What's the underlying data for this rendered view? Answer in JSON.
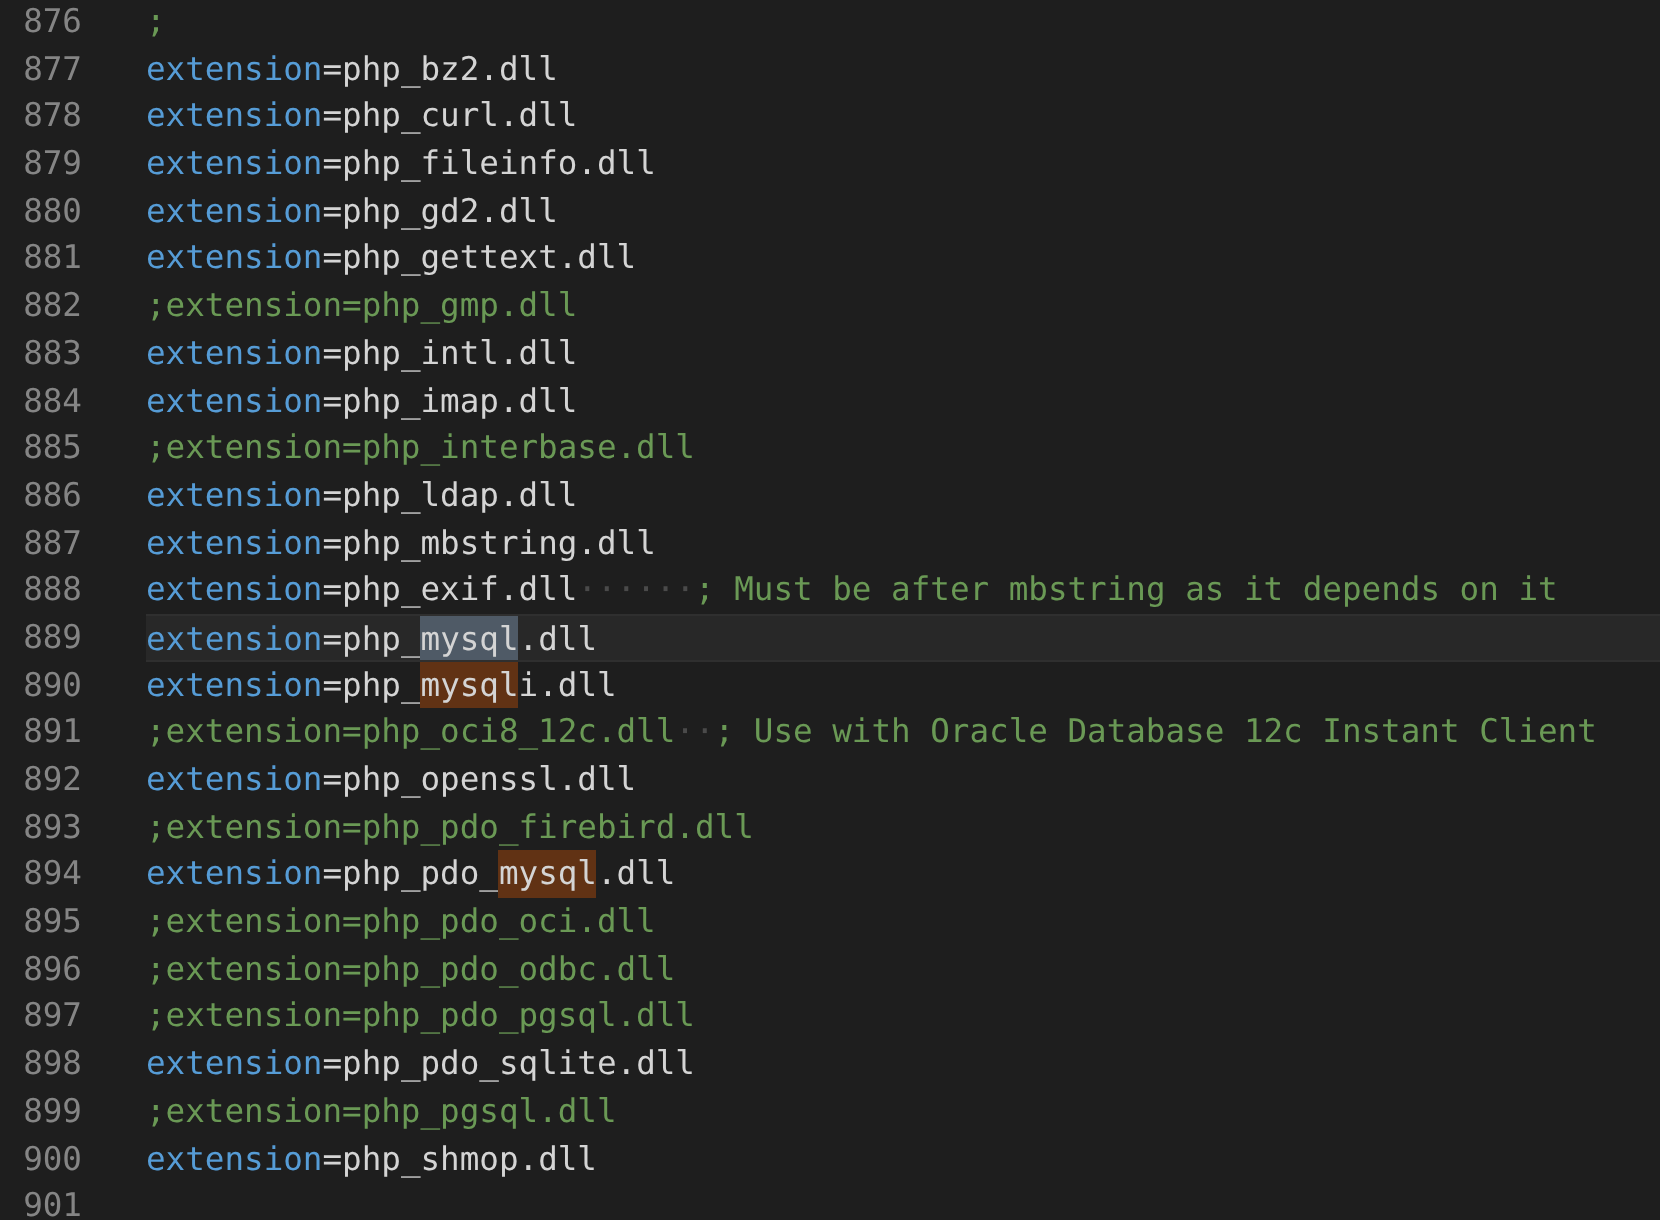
{
  "editor": {
    "lines": [
      {
        "number": "876",
        "current": false,
        "tokens": [
          {
            "kind": "comment",
            "text": ";"
          }
        ]
      },
      {
        "number": "877",
        "current": false,
        "tokens": [
          {
            "kind": "key",
            "text": "extension"
          },
          {
            "kind": "operator",
            "text": "="
          },
          {
            "kind": "value",
            "text": "php_bz2.dll"
          }
        ]
      },
      {
        "number": "878",
        "current": false,
        "tokens": [
          {
            "kind": "key",
            "text": "extension"
          },
          {
            "kind": "operator",
            "text": "="
          },
          {
            "kind": "value",
            "text": "php_curl.dll"
          }
        ]
      },
      {
        "number": "879",
        "current": false,
        "tokens": [
          {
            "kind": "key",
            "text": "extension"
          },
          {
            "kind": "operator",
            "text": "="
          },
          {
            "kind": "value",
            "text": "php_fileinfo.dll"
          }
        ]
      },
      {
        "number": "880",
        "current": false,
        "tokens": [
          {
            "kind": "key",
            "text": "extension"
          },
          {
            "kind": "operator",
            "text": "="
          },
          {
            "kind": "value",
            "text": "php_gd2.dll"
          }
        ]
      },
      {
        "number": "881",
        "current": false,
        "tokens": [
          {
            "kind": "key",
            "text": "extension"
          },
          {
            "kind": "operator",
            "text": "="
          },
          {
            "kind": "value",
            "text": "php_gettext.dll"
          }
        ]
      },
      {
        "number": "882",
        "current": false,
        "tokens": [
          {
            "kind": "comment",
            "text": ";extension=php_gmp.dll"
          }
        ]
      },
      {
        "number": "883",
        "current": false,
        "tokens": [
          {
            "kind": "key",
            "text": "extension"
          },
          {
            "kind": "operator",
            "text": "="
          },
          {
            "kind": "value",
            "text": "php_intl.dll"
          }
        ]
      },
      {
        "number": "884",
        "current": false,
        "tokens": [
          {
            "kind": "key",
            "text": "extension"
          },
          {
            "kind": "operator",
            "text": "="
          },
          {
            "kind": "value",
            "text": "php_imap.dll"
          }
        ]
      },
      {
        "number": "885",
        "current": false,
        "tokens": [
          {
            "kind": "comment",
            "text": ";extension=php_interbase.dll"
          }
        ]
      },
      {
        "number": "886",
        "current": false,
        "tokens": [
          {
            "kind": "key",
            "text": "extension"
          },
          {
            "kind": "operator",
            "text": "="
          },
          {
            "kind": "value",
            "text": "php_ldap.dll"
          }
        ]
      },
      {
        "number": "887",
        "current": false,
        "tokens": [
          {
            "kind": "key",
            "text": "extension"
          },
          {
            "kind": "operator",
            "text": "="
          },
          {
            "kind": "value",
            "text": "php_mbstring.dll"
          }
        ]
      },
      {
        "number": "888",
        "current": false,
        "tokens": [
          {
            "kind": "key",
            "text": "extension"
          },
          {
            "kind": "operator",
            "text": "="
          },
          {
            "kind": "value",
            "text": "php_exif.dll"
          },
          {
            "kind": "whitespace",
            "text": "······"
          },
          {
            "kind": "comment",
            "text": "; Must be after mbstring as it depends on it"
          }
        ]
      },
      {
        "number": "889",
        "current": true,
        "tokens": [
          {
            "kind": "key",
            "text": "extension"
          },
          {
            "kind": "operator",
            "text": "="
          },
          {
            "kind": "value",
            "text": "php_"
          },
          {
            "kind": "selection",
            "text": "mysql"
          },
          {
            "kind": "value",
            "text": ".dll"
          }
        ]
      },
      {
        "number": "890",
        "current": false,
        "tokens": [
          {
            "kind": "key",
            "text": "extension"
          },
          {
            "kind": "operator",
            "text": "="
          },
          {
            "kind": "value",
            "text": "php_"
          },
          {
            "kind": "match",
            "text": "mysql"
          },
          {
            "kind": "value",
            "text": "i.dll"
          }
        ]
      },
      {
        "number": "891",
        "current": false,
        "tokens": [
          {
            "kind": "comment",
            "text": ";extension=php_oci8_12c.dll"
          },
          {
            "kind": "whitespace",
            "text": "··"
          },
          {
            "kind": "comment",
            "text": "; Use with Oracle Database 12c Instant Client"
          }
        ]
      },
      {
        "number": "892",
        "current": false,
        "tokens": [
          {
            "kind": "key",
            "text": "extension"
          },
          {
            "kind": "operator",
            "text": "="
          },
          {
            "kind": "value",
            "text": "php_openssl.dll"
          }
        ]
      },
      {
        "number": "893",
        "current": false,
        "tokens": [
          {
            "kind": "comment",
            "text": ";extension=php_pdo_firebird.dll"
          }
        ]
      },
      {
        "number": "894",
        "current": false,
        "tokens": [
          {
            "kind": "key",
            "text": "extension"
          },
          {
            "kind": "operator",
            "text": "="
          },
          {
            "kind": "value",
            "text": "php_pdo_"
          },
          {
            "kind": "match",
            "text": "mysql"
          },
          {
            "kind": "value",
            "text": ".dll"
          }
        ]
      },
      {
        "number": "895",
        "current": false,
        "tokens": [
          {
            "kind": "comment",
            "text": ";extension=php_pdo_oci.dll"
          }
        ]
      },
      {
        "number": "896",
        "current": false,
        "tokens": [
          {
            "kind": "comment",
            "text": ";extension=php_pdo_odbc.dll"
          }
        ]
      },
      {
        "number": "897",
        "current": false,
        "tokens": [
          {
            "kind": "comment",
            "text": ";extension=php_pdo_pgsql.dll"
          }
        ]
      },
      {
        "number": "898",
        "current": false,
        "tokens": [
          {
            "kind": "key",
            "text": "extension"
          },
          {
            "kind": "operator",
            "text": "="
          },
          {
            "kind": "value",
            "text": "php_pdo_sqlite.dll"
          }
        ]
      },
      {
        "number": "899",
        "current": false,
        "tokens": [
          {
            "kind": "comment",
            "text": ";extension=php_pgsql.dll"
          }
        ]
      },
      {
        "number": "900",
        "current": false,
        "tokens": [
          {
            "kind": "key",
            "text": "extension"
          },
          {
            "kind": "operator",
            "text": "="
          },
          {
            "kind": "value",
            "text": "php_shmop.dll"
          }
        ]
      },
      {
        "number": "901",
        "current": false
      }
    ]
  }
}
